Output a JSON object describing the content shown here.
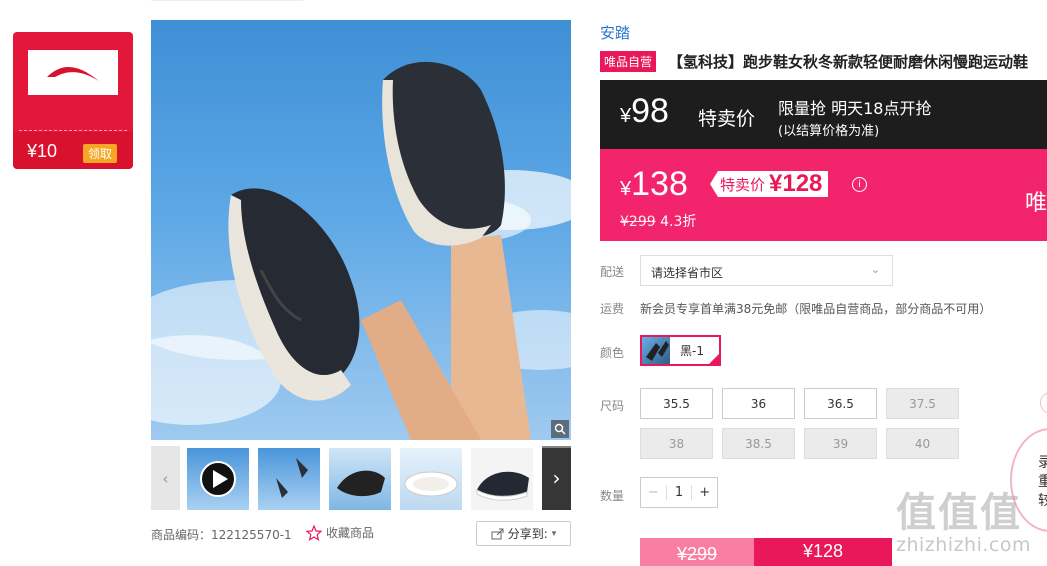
{
  "coupon": {
    "amount": "¥10",
    "claim_label": "领取"
  },
  "gallery": {
    "product_code": "商品编码：122125570-1",
    "favorite_label": "收藏商品",
    "share_label": "分享到:"
  },
  "product": {
    "brand": "安踏",
    "vip_badge": "唯品自营",
    "title": "【氢科技】跑步鞋女秋冬新款轻便耐磨休闲慢跑运动鞋"
  },
  "flash": {
    "currency": "¥",
    "price": "98",
    "label": "特卖价",
    "title": "限量抢 明天18点开抢",
    "subtitle": "(以结算价格为准)"
  },
  "price": {
    "currency": "¥",
    "current": "138",
    "special_label": "特卖价",
    "special_price": "¥128",
    "original": "¥299",
    "discount": "4.3折",
    "side_text": "唯"
  },
  "delivery": {
    "label": "配送",
    "placeholder": "请选择省市区"
  },
  "shipping": {
    "label": "运费",
    "text": "新会员专享首单满38元免邮（限唯品自营商品，部分商品不可用）"
  },
  "color": {
    "label": "颜色",
    "selected": "黑-1"
  },
  "size": {
    "label": "尺码",
    "options": [
      {
        "value": "35.5",
        "available": true
      },
      {
        "value": "36",
        "available": true
      },
      {
        "value": "36.5",
        "available": true
      },
      {
        "value": "37.5",
        "available": false
      },
      {
        "value": "38",
        "available": false
      },
      {
        "value": "38.5",
        "available": false
      },
      {
        "value": "39",
        "available": false
      },
      {
        "value": "40",
        "available": false
      }
    ]
  },
  "quantity": {
    "label": "数量",
    "value": "1",
    "minus": "−",
    "plus": "+"
  },
  "buy": {
    "original": "¥299",
    "price": "¥128"
  },
  "side_panel": {
    "line1": "录",
    "line2": "重",
    "line3": "较"
  },
  "watermark": {
    "big": "值值值",
    "small": "zhizhizhi.com"
  },
  "colors": {
    "accent": "#e8185a",
    "dark": "#1d1d1d",
    "brand_link": "#2b74d0",
    "coupon": "#e3173a"
  }
}
